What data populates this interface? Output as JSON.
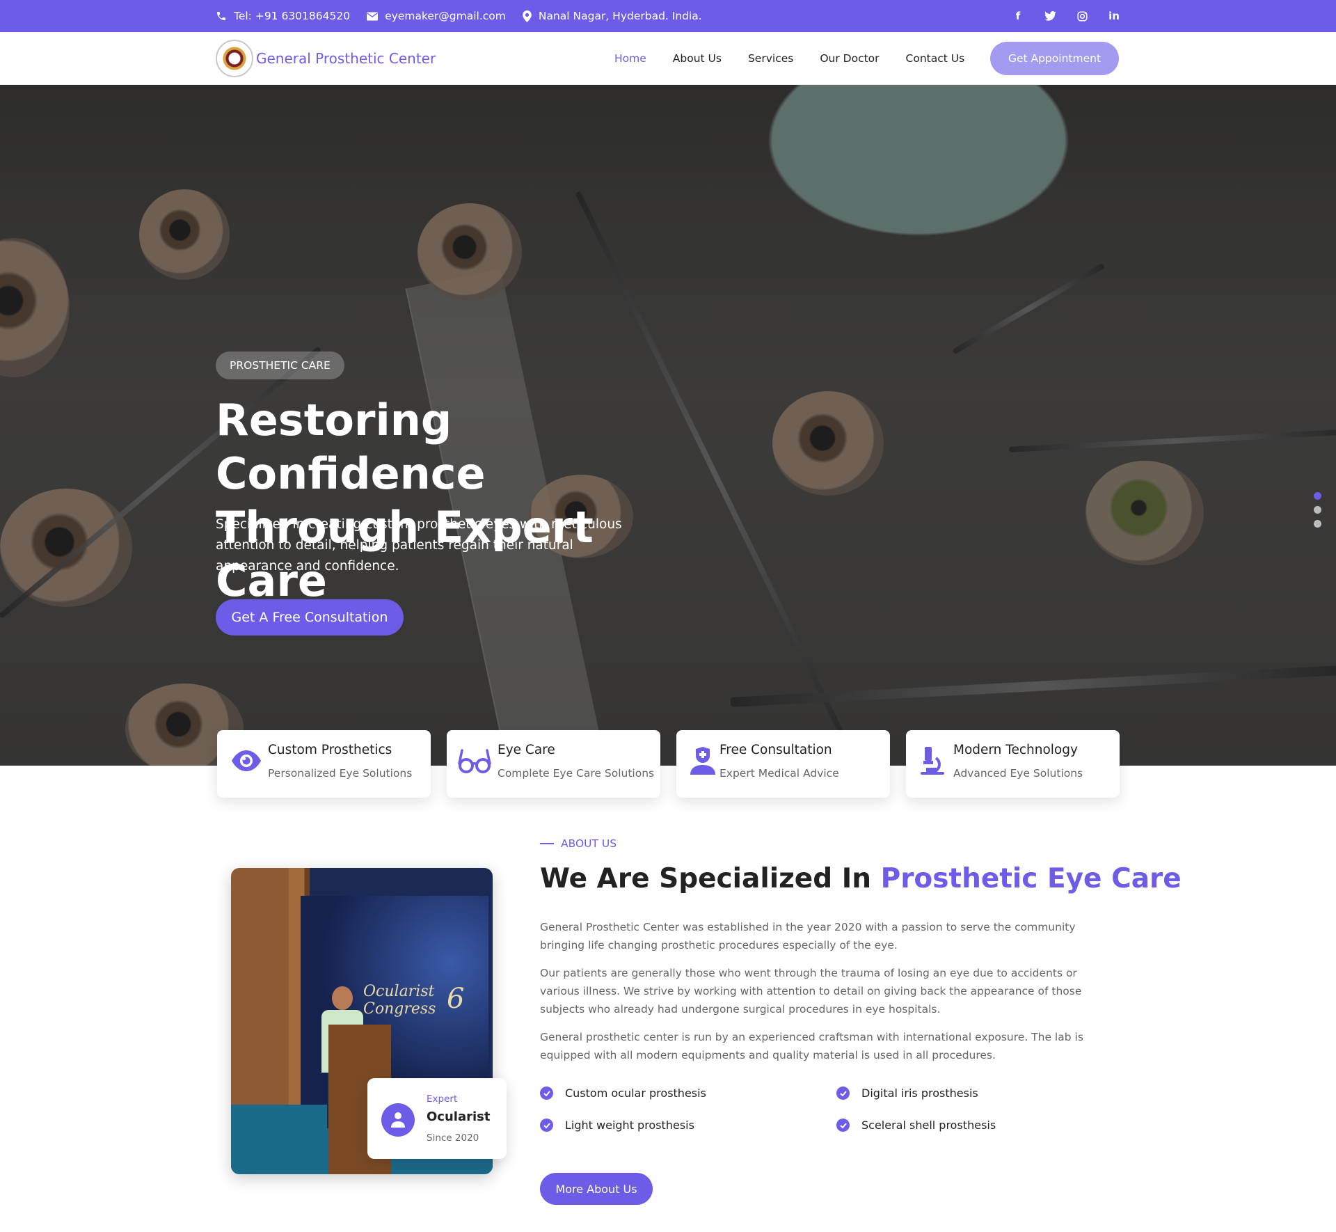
{
  "topbar": {
    "phone": "Tel: +91 6301864520",
    "email": "eyemaker@gmail.com",
    "address": "Nanal Nagar, Hyderbad. India.",
    "social": [
      {
        "icon": "facebook-icon",
        "glyph": "f"
      },
      {
        "icon": "twitter-icon",
        "glyph": "🐦"
      },
      {
        "icon": "instagram-icon",
        "glyph": "◎"
      },
      {
        "icon": "linkedin-icon",
        "glyph": "in"
      }
    ]
  },
  "nav": {
    "brand": "General Prosthetic Center",
    "items": [
      "Home",
      "About Us",
      "Services",
      "Our Doctor",
      "Contact Us"
    ],
    "active": "Home",
    "cta": "Get Appointment"
  },
  "hero": {
    "badge": "PROSTHETIC CARE",
    "title_line1": "Restoring Confidence",
    "title_line2": "Through Expert Care",
    "lead": "Specialized in creating custom prosthetic eyes with meticulous attention to detail, helping patients regain their natural appearance and confidence.",
    "cta": "Get A Free Consultation",
    "slides": 3,
    "active_slide": 1
  },
  "features": [
    {
      "icon": "eye-icon",
      "title": "Custom Prosthetics",
      "subtitle": "Personalized Eye Solutions"
    },
    {
      "icon": "glasses-icon",
      "title": "Eye Care",
      "subtitle": "Complete Eye Care Solutions"
    },
    {
      "icon": "doctor-icon",
      "title": "Free Consultation",
      "subtitle": "Expert Medical Advice"
    },
    {
      "icon": "microscope-icon",
      "title": "Modern Technology",
      "subtitle": "Advanced Eye Solutions"
    }
  ],
  "about": {
    "eyebrow": "ABOUT US",
    "title_plain": "We Are Specialized In ",
    "title_highlight": "Prosthetic Eye Care",
    "paragraphs": [
      "General Prosthetic Center was established in the year 2020 with a passion to serve the community bringing life changing prosthetic procedures especially of the eye.",
      "Our patients are generally those who went through the trauma of losing an eye due to accidents or various illness. We strive by working with attention to detail on giving back the appearance of those subjects who already had undergone surgical procedures in eye hospitals.",
      "General prosthetic center is run by an experienced craftsman with international exposure. The lab is equipped with all modern equipments and quality material is used in all procedures."
    ],
    "checklist": [
      "Custom ocular prosthesis",
      "Digital iris prosthesis",
      "Light weight prosthesis",
      "Sceleral shell prosthesis"
    ],
    "cta": "More About Us",
    "expert": {
      "label": "Expert",
      "role": "Ocularist",
      "since": "Since 2020"
    },
    "photo_text": {
      "line1": "Ocularist",
      "line2": "Congress",
      "number": "6"
    }
  },
  "colors": {
    "accent": "#6c5ce7",
    "accent_light": "#a29bf0"
  }
}
